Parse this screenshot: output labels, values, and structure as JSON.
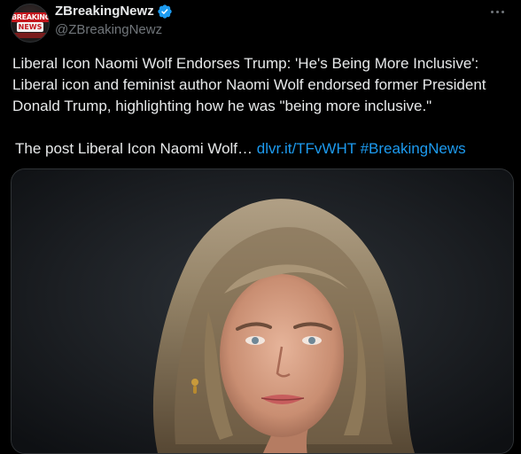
{
  "tweet": {
    "avatar": {
      "line1": "BREAKING",
      "line2": "NEWS"
    },
    "display_name": "ZBreakingNewz",
    "handle": "@ZBreakingNewz",
    "text_headline": "Liberal Icon Naomi Wolf Endorses Trump: 'He's Being More Inclusive': Liberal icon and feminist author Naomi Wolf endorsed former President Donald Trump, highlighting how he was \"being more inclusive.\"",
    "text_prefix": "The post Liberal Icon Naomi Wolf…",
    "link_text": "dlvr.it/TFvWHT",
    "hashtag": "#BreakingNews"
  },
  "colors": {
    "background": "#000000",
    "text": "#e7e9ea",
    "secondary": "#71767b",
    "link": "#1d9bf0",
    "verified": "#1d9bf0"
  },
  "icons": [
    "verified-badge-icon",
    "more-options-icon"
  ]
}
